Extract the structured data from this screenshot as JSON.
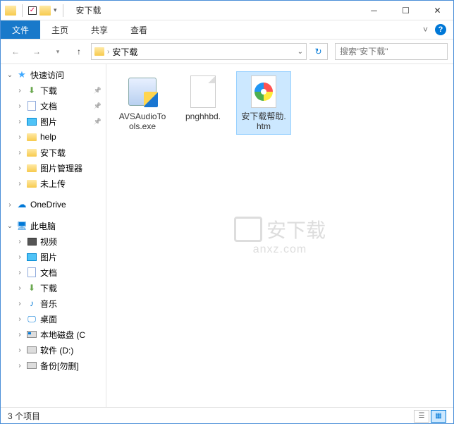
{
  "title": "安下载",
  "ribbon": {
    "file": "文件",
    "home": "主页",
    "share": "共享",
    "view": "查看"
  },
  "breadcrumb": {
    "current": "安下载"
  },
  "search": {
    "placeholder": "搜索\"安下载\""
  },
  "sidebar": {
    "quick_access": "快速访问",
    "items_quick": [
      {
        "label": "下载",
        "icon": "download",
        "pinned": true
      },
      {
        "label": "文档",
        "icon": "document",
        "pinned": true
      },
      {
        "label": "图片",
        "icon": "picture",
        "pinned": true
      },
      {
        "label": "help",
        "icon": "folder",
        "pinned": false
      },
      {
        "label": "安下载",
        "icon": "folder",
        "pinned": false
      },
      {
        "label": "图片管理器",
        "icon": "folder",
        "pinned": false
      },
      {
        "label": "未上传",
        "icon": "folder",
        "pinned": false
      }
    ],
    "onedrive": "OneDrive",
    "this_pc": "此电脑",
    "items_pc": [
      {
        "label": "视频",
        "icon": "video"
      },
      {
        "label": "图片",
        "icon": "picture"
      },
      {
        "label": "文档",
        "icon": "document"
      },
      {
        "label": "下载",
        "icon": "download"
      },
      {
        "label": "音乐",
        "icon": "music"
      },
      {
        "label": "桌面",
        "icon": "desktop"
      },
      {
        "label": "本地磁盘 (C",
        "icon": "drive-c"
      },
      {
        "label": "软件 (D:)",
        "icon": "drive"
      },
      {
        "label": "备份[勿删]",
        "icon": "drive"
      }
    ]
  },
  "files": [
    {
      "name": "AVSAudioTools.exe",
      "type": "exe",
      "selected": false
    },
    {
      "name": "pnghhbd.",
      "type": "blank",
      "selected": false
    },
    {
      "name": "安下载帮助.htm",
      "type": "htm",
      "selected": true
    }
  ],
  "status": {
    "count": "3 个项目"
  },
  "watermark": {
    "main": "安下载",
    "sub": "anxz.com"
  }
}
